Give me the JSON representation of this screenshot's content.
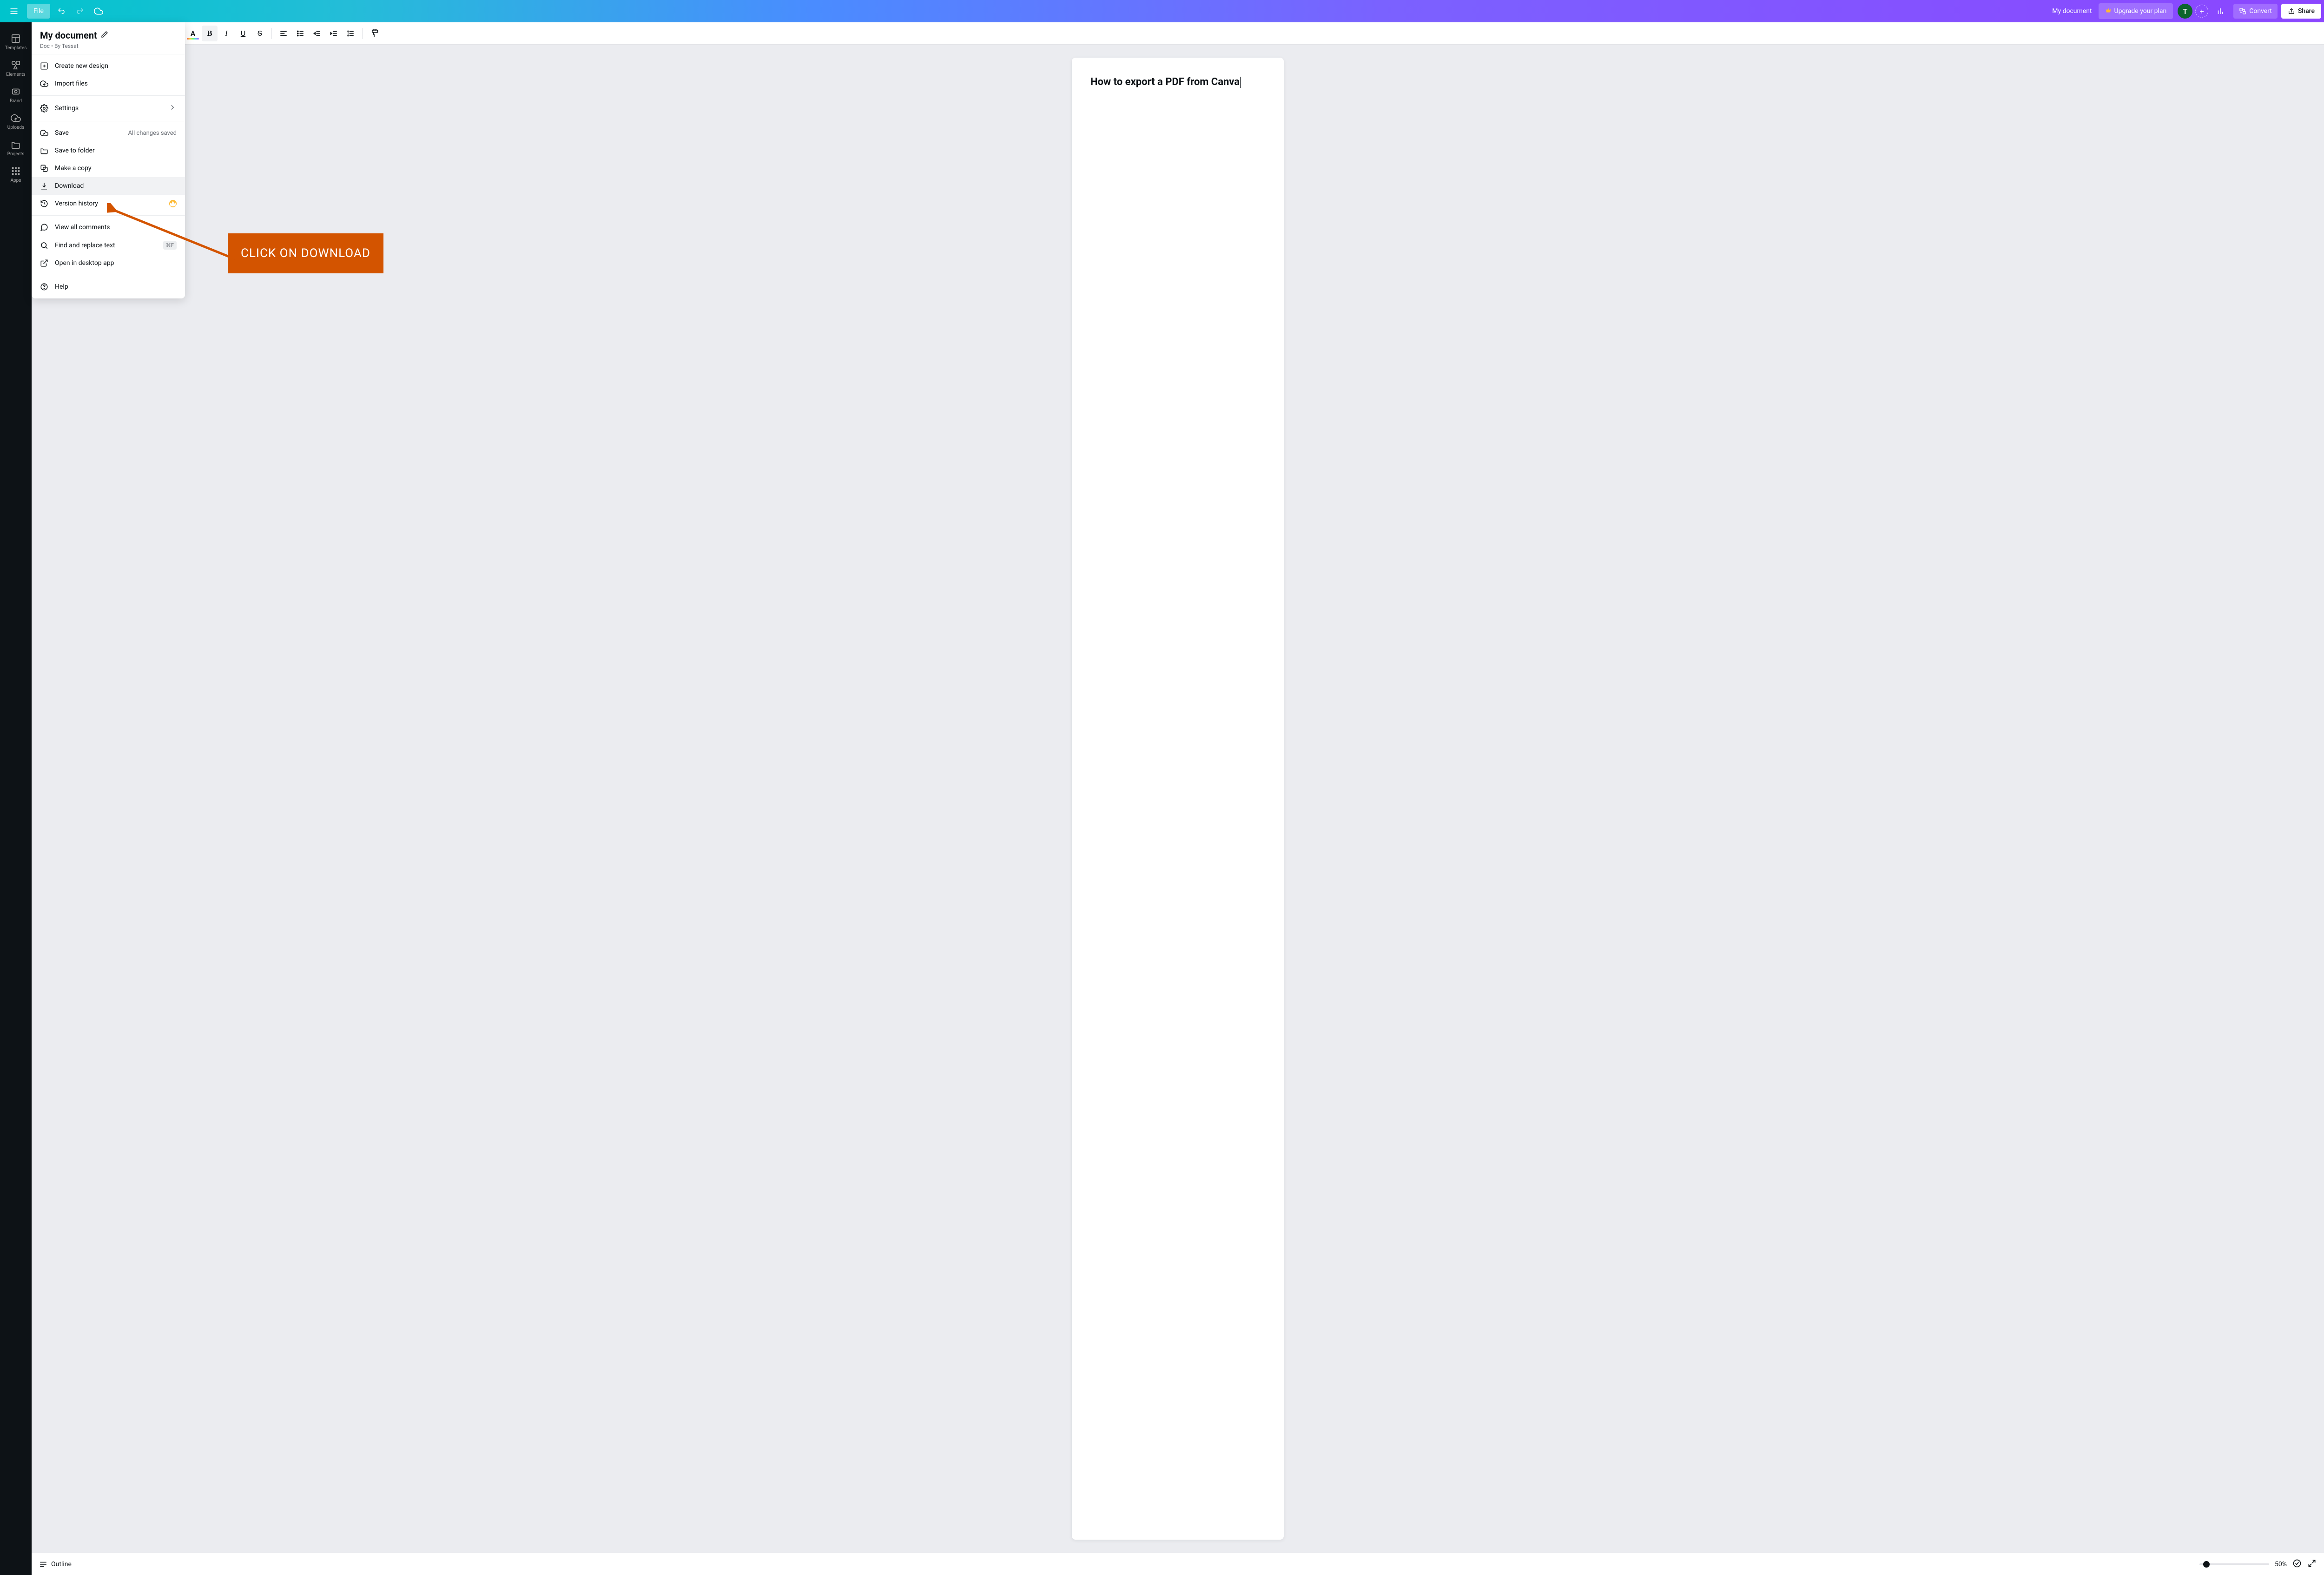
{
  "topbar": {
    "file_label": "File",
    "doc_name": "My document",
    "upgrade_label": "Upgrade your plan",
    "avatar_initial": "T",
    "convert_label": "Convert",
    "share_label": "Share"
  },
  "left_rail": {
    "items": [
      "Templates",
      "Elements",
      "Brand",
      "Uploads",
      "Projects",
      "Apps"
    ]
  },
  "toolbar": {
    "bold": "B",
    "italic": "I",
    "underline": "U",
    "strike": "S"
  },
  "document": {
    "heading": "How to export a PDF from Canva"
  },
  "file_menu": {
    "title": "My document",
    "subtitle": "Doc • By Tessat",
    "create": "Create new design",
    "import": "Import files",
    "settings": "Settings",
    "save": "Save",
    "save_hint": "All changes saved",
    "save_folder": "Save to folder",
    "make_copy": "Make a copy",
    "download": "Download",
    "version_history": "Version history",
    "view_comments": "View all comments",
    "find_replace": "Find and replace text",
    "find_kbd": "⌘F",
    "open_desktop": "Open in desktop app",
    "help": "Help"
  },
  "bottombar": {
    "outline_label": "Outline",
    "zoom_label": "50%"
  },
  "annotation": {
    "text": "CLICK ON DOWNLOAD"
  }
}
